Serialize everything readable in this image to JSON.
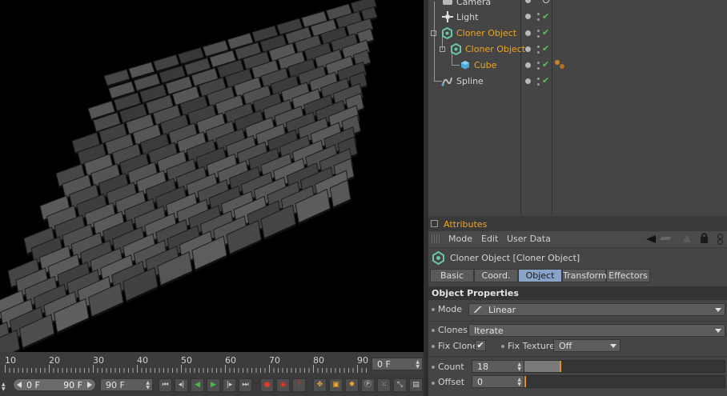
{
  "object_manager": {
    "objects": [
      {
        "name": "Camera",
        "selected": false
      },
      {
        "name": "Light",
        "selected": false
      },
      {
        "name": "Cloner Object",
        "selected": true
      },
      {
        "name": "Cloner Object",
        "selected": true
      },
      {
        "name": "Cube",
        "selected": true
      },
      {
        "name": "Spline",
        "selected": false
      }
    ]
  },
  "attributes": {
    "title": "Attributes",
    "menu": [
      "Mode",
      "Edit",
      "User Data"
    ],
    "object_name": "Cloner Object [Cloner Object]",
    "tabs": [
      "Basic",
      "Coord.",
      "Object",
      "Transform",
      "Effectors"
    ],
    "active_tab": "Object",
    "section_title": "Object Properties",
    "mode": {
      "label": "Mode",
      "value": "Linear"
    },
    "clones": {
      "label": "Clones",
      "value": "Iterate"
    },
    "fix_clone": {
      "label": "Fix Clone",
      "checked": true,
      "check_glyph": "✔"
    },
    "fix_texture": {
      "label": "Fix Texture",
      "value": "Off"
    },
    "count": {
      "label": "Count",
      "value": "18",
      "slider_fraction": 0.18
    },
    "offset": {
      "label": "Offset",
      "value": "0",
      "slider_fraction": 0.0
    }
  },
  "timeline": {
    "ticks": [
      "10",
      "20",
      "30",
      "40",
      "50",
      "60",
      "70",
      "80",
      "90"
    ],
    "current_frame": "0 F"
  },
  "transport": {
    "start_frame": "0 F",
    "end_frame": "90 F",
    "max_frame": "90 F"
  },
  "colors": {
    "selected_text": "#f1a51d",
    "check": "#52c45a",
    "active_tab": "#8aa3c9"
  }
}
